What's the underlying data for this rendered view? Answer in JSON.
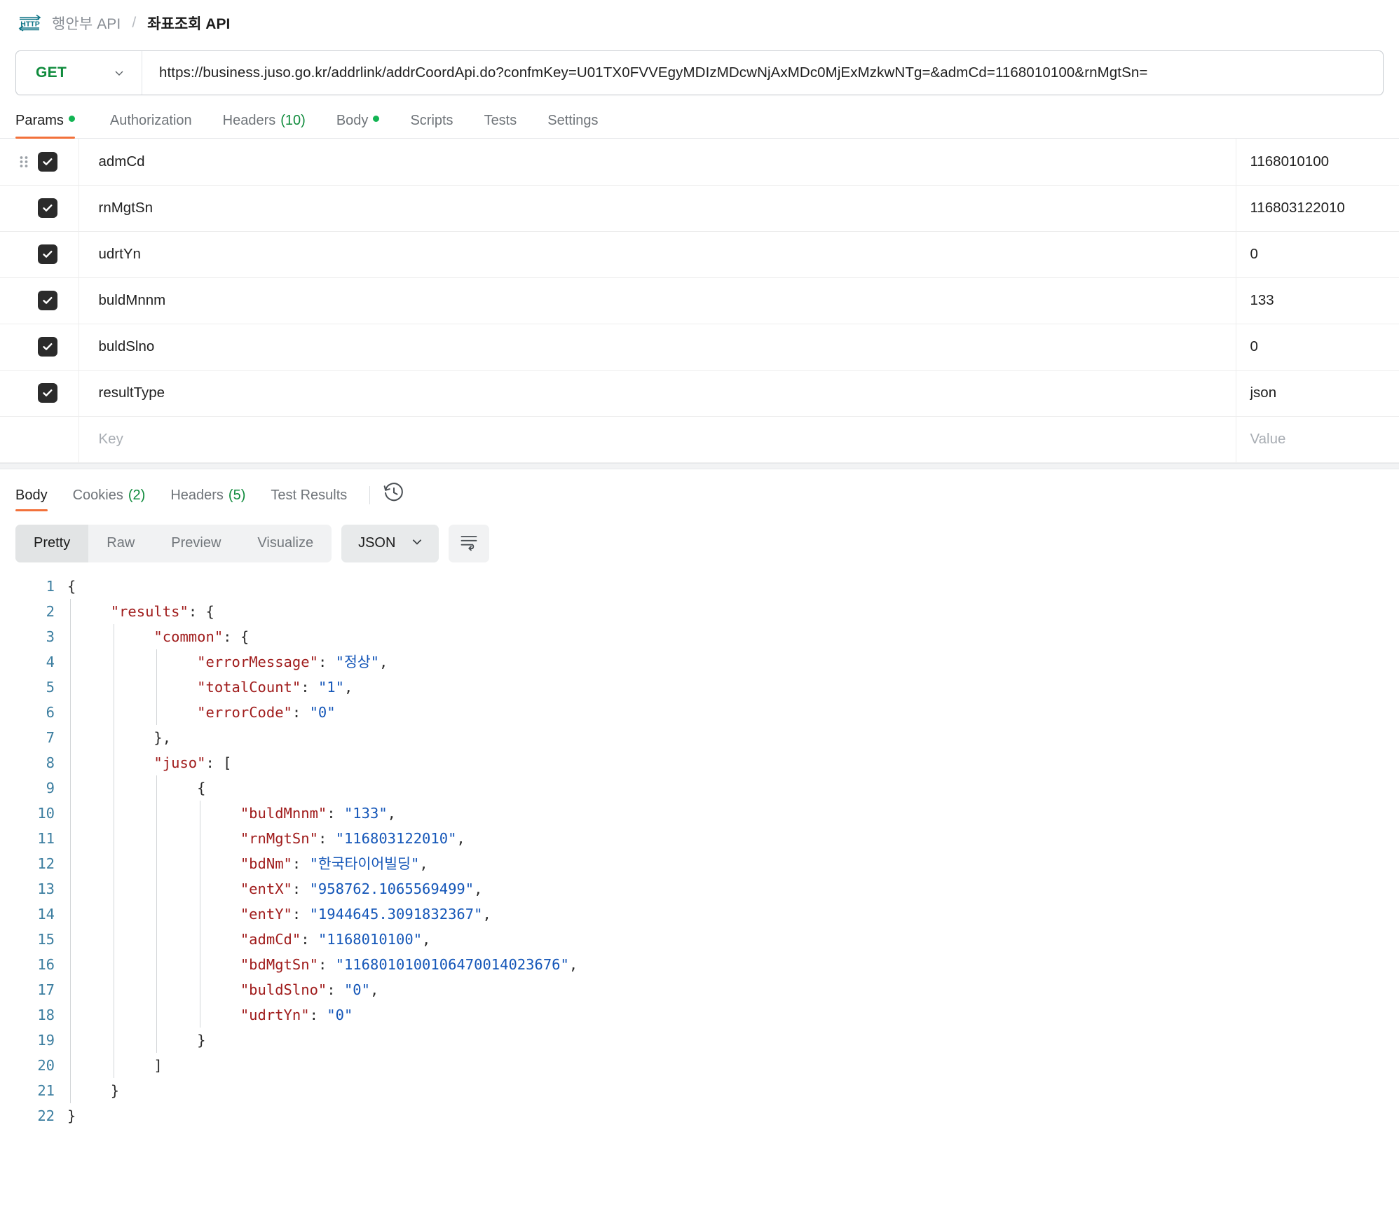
{
  "breadcrumb": {
    "icon": "http-protocol-icon",
    "parent": "행안부 API",
    "separator": "/",
    "current": "좌표조회 API"
  },
  "request": {
    "method": "GET",
    "url": "https://business.juso.go.kr/addrlink/addrCoordApi.do?confmKey=U01TX0FVVEgyMDIzMDcwNjAxMDc0MjExMzkwNTg=&admCd=1168010100&rnMgtSn=",
    "tabs": [
      {
        "label": "Params",
        "badge": "",
        "dot": true,
        "active": true
      },
      {
        "label": "Authorization",
        "badge": "",
        "dot": false,
        "active": false
      },
      {
        "label": "Headers",
        "badge": "(10)",
        "dot": false,
        "active": false
      },
      {
        "label": "Body",
        "badge": "",
        "dot": true,
        "active": false
      },
      {
        "label": "Scripts",
        "badge": "",
        "dot": false,
        "active": false
      },
      {
        "label": "Tests",
        "badge": "",
        "dot": false,
        "active": false
      },
      {
        "label": "Settings",
        "badge": "",
        "dot": false,
        "active": false
      }
    ]
  },
  "params": {
    "placeholder_key": "Key",
    "placeholder_value": "Value",
    "rows": [
      {
        "checked": true,
        "key": "admCd",
        "value": "1168010100"
      },
      {
        "checked": true,
        "key": "rnMgtSn",
        "value": "116803122010"
      },
      {
        "checked": true,
        "key": "udrtYn",
        "value": "0"
      },
      {
        "checked": true,
        "key": "buldMnnm",
        "value": "133"
      },
      {
        "checked": true,
        "key": "buldSlno",
        "value": "0"
      },
      {
        "checked": true,
        "key": "resultType",
        "value": "json"
      }
    ]
  },
  "response": {
    "tabs": [
      {
        "label": "Body",
        "badge": "",
        "active": true
      },
      {
        "label": "Cookies",
        "badge": "(2)",
        "active": false
      },
      {
        "label": "Headers",
        "badge": "(5)",
        "active": false
      },
      {
        "label": "Test Results",
        "badge": "",
        "active": false
      }
    ],
    "history_icon": "history-clock-icon",
    "format_tabs": [
      {
        "label": "Pretty",
        "active": true
      },
      {
        "label": "Raw",
        "active": false
      },
      {
        "label": "Preview",
        "active": false
      },
      {
        "label": "Visualize",
        "active": false
      }
    ],
    "language": "JSON",
    "wrap_icon": "wrap-lines-icon"
  },
  "body_json": {
    "results": {
      "common": {
        "errorMessage": "정상",
        "totalCount": "1",
        "errorCode": "0"
      },
      "juso": [
        {
          "buldMnnm": "133",
          "rnMgtSn": "116803122010",
          "bdNm": "한국타이어빌딩",
          "entX": "958762.1065569499",
          "entY": "1944645.3091832367",
          "admCd": "1168010100",
          "bdMgtSn": "1168010100106470014023676",
          "buldSlno": "0",
          "udrtYn": "0"
        }
      ]
    }
  },
  "code_lines": [
    {
      "n": 1,
      "indent": 0,
      "tokens": [
        {
          "t": "p",
          "v": "{"
        }
      ]
    },
    {
      "n": 2,
      "indent": 1,
      "tokens": [
        {
          "t": "k",
          "v": "\"results\""
        },
        {
          "t": "p",
          "v": ": {"
        }
      ]
    },
    {
      "n": 3,
      "indent": 2,
      "tokens": [
        {
          "t": "k",
          "v": "\"common\""
        },
        {
          "t": "p",
          "v": ": {"
        }
      ]
    },
    {
      "n": 4,
      "indent": 3,
      "tokens": [
        {
          "t": "k",
          "v": "\"errorMessage\""
        },
        {
          "t": "p",
          "v": ": "
        },
        {
          "t": "s",
          "v": "\"정상\""
        },
        {
          "t": "p",
          "v": ","
        }
      ]
    },
    {
      "n": 5,
      "indent": 3,
      "tokens": [
        {
          "t": "k",
          "v": "\"totalCount\""
        },
        {
          "t": "p",
          "v": ": "
        },
        {
          "t": "s",
          "v": "\"1\""
        },
        {
          "t": "p",
          "v": ","
        }
      ]
    },
    {
      "n": 6,
      "indent": 3,
      "tokens": [
        {
          "t": "k",
          "v": "\"errorCode\""
        },
        {
          "t": "p",
          "v": ": "
        },
        {
          "t": "s",
          "v": "\"0\""
        }
      ]
    },
    {
      "n": 7,
      "indent": 2,
      "tokens": [
        {
          "t": "p",
          "v": "},"
        }
      ]
    },
    {
      "n": 8,
      "indent": 2,
      "tokens": [
        {
          "t": "k",
          "v": "\"juso\""
        },
        {
          "t": "p",
          "v": ": ["
        }
      ]
    },
    {
      "n": 9,
      "indent": 3,
      "tokens": [
        {
          "t": "p",
          "v": "{"
        }
      ]
    },
    {
      "n": 10,
      "indent": 4,
      "tokens": [
        {
          "t": "k",
          "v": "\"buldMnnm\""
        },
        {
          "t": "p",
          "v": ": "
        },
        {
          "t": "s",
          "v": "\"133\""
        },
        {
          "t": "p",
          "v": ","
        }
      ]
    },
    {
      "n": 11,
      "indent": 4,
      "tokens": [
        {
          "t": "k",
          "v": "\"rnMgtSn\""
        },
        {
          "t": "p",
          "v": ": "
        },
        {
          "t": "s",
          "v": "\"116803122010\""
        },
        {
          "t": "p",
          "v": ","
        }
      ]
    },
    {
      "n": 12,
      "indent": 4,
      "tokens": [
        {
          "t": "k",
          "v": "\"bdNm\""
        },
        {
          "t": "p",
          "v": ": "
        },
        {
          "t": "s",
          "v": "\"한국타이어빌딩\""
        },
        {
          "t": "p",
          "v": ","
        }
      ]
    },
    {
      "n": 13,
      "indent": 4,
      "tokens": [
        {
          "t": "k",
          "v": "\"entX\""
        },
        {
          "t": "p",
          "v": ": "
        },
        {
          "t": "s",
          "v": "\"958762.1065569499\""
        },
        {
          "t": "p",
          "v": ","
        }
      ]
    },
    {
      "n": 14,
      "indent": 4,
      "tokens": [
        {
          "t": "k",
          "v": "\"entY\""
        },
        {
          "t": "p",
          "v": ": "
        },
        {
          "t": "s",
          "v": "\"1944645.3091832367\""
        },
        {
          "t": "p",
          "v": ","
        }
      ]
    },
    {
      "n": 15,
      "indent": 4,
      "tokens": [
        {
          "t": "k",
          "v": "\"admCd\""
        },
        {
          "t": "p",
          "v": ": "
        },
        {
          "t": "s",
          "v": "\"1168010100\""
        },
        {
          "t": "p",
          "v": ","
        }
      ]
    },
    {
      "n": 16,
      "indent": 4,
      "tokens": [
        {
          "t": "k",
          "v": "\"bdMgtSn\""
        },
        {
          "t": "p",
          "v": ": "
        },
        {
          "t": "s",
          "v": "\"1168010100106470014023676\""
        },
        {
          "t": "p",
          "v": ","
        }
      ]
    },
    {
      "n": 17,
      "indent": 4,
      "tokens": [
        {
          "t": "k",
          "v": "\"buldSlno\""
        },
        {
          "t": "p",
          "v": ": "
        },
        {
          "t": "s",
          "v": "\"0\""
        },
        {
          "t": "p",
          "v": ","
        }
      ]
    },
    {
      "n": 18,
      "indent": 4,
      "tokens": [
        {
          "t": "k",
          "v": "\"udrtYn\""
        },
        {
          "t": "p",
          "v": ": "
        },
        {
          "t": "s",
          "v": "\"0\""
        }
      ]
    },
    {
      "n": 19,
      "indent": 3,
      "tokens": [
        {
          "t": "p",
          "v": "}"
        }
      ]
    },
    {
      "n": 20,
      "indent": 2,
      "tokens": [
        {
          "t": "p",
          "v": "]"
        }
      ]
    },
    {
      "n": 21,
      "indent": 1,
      "tokens": [
        {
          "t": "p",
          "v": "}"
        }
      ]
    },
    {
      "n": 22,
      "indent": 0,
      "tokens": [
        {
          "t": "p",
          "v": "}"
        }
      ]
    }
  ],
  "colors": {
    "accent_orange": "#f2713a",
    "method_green": "#0f8b3c",
    "dot_green": "#12b453",
    "json_key": "#a01c1c",
    "json_string": "#1456b8",
    "gutter": "#3c7ea0",
    "http_icon": "#0b7285"
  }
}
